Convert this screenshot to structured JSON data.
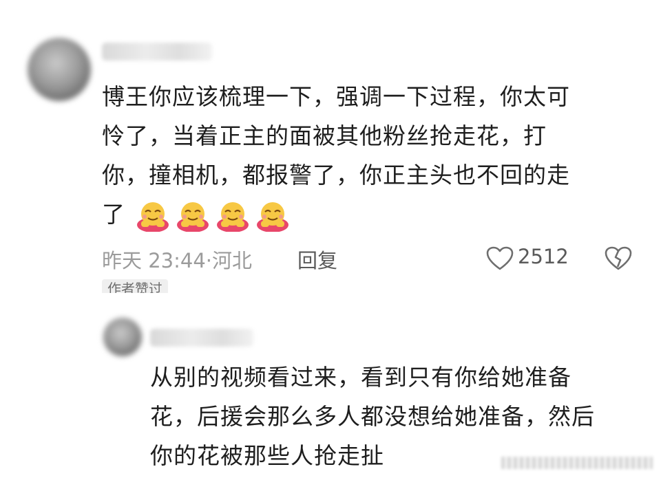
{
  "comment": {
    "text_lines": [
      "博王你应该梳理一下，强调一下过程，你太可",
      "怜了，当着正主的面被其他粉丝抢走花，打",
      "你，撞相机，都报警了，你正主头也不回的走",
      "了"
    ],
    "emojis": [
      "hugging-emoji",
      "hugging-emoji",
      "hugging-emoji",
      "hugging-emoji"
    ],
    "time_location": "昨天 23:44·河北",
    "reply_label": "回复",
    "like_count": "2512",
    "author_liked_badge": "作者赞过"
  },
  "reply": {
    "text_lines": [
      "从别的视频看过来，看到只有你给她准备",
      "花，后援会那么多人都没想给她准备，然后",
      "你的花被那些人抢走扯"
    ]
  },
  "colors": {
    "text": "#1e1e1e",
    "meta": "#9b9b9b",
    "badge_bg": "#efefef",
    "emoji_face": "#f7c844",
    "emoji_body": "#e8476a"
  }
}
